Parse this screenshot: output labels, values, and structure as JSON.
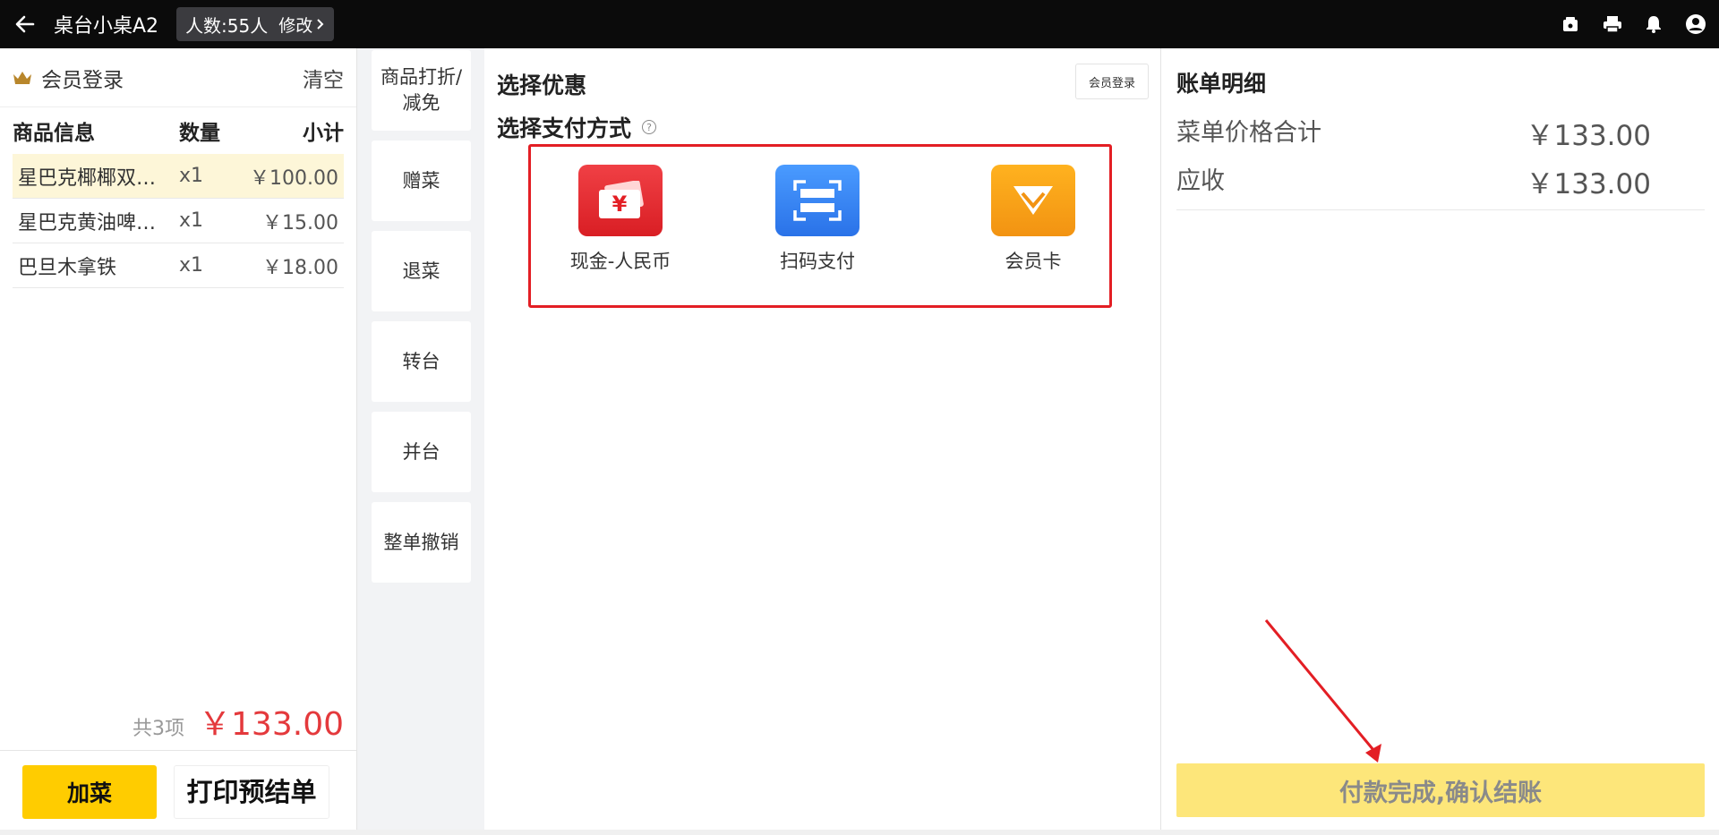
{
  "header": {
    "title": "桌台小桌A2",
    "people_label": "人数:55人",
    "edit_label": "修改",
    "icons": [
      "back-arrow-icon",
      "cash-drawer-icon",
      "printer-icon",
      "bell-icon",
      "user-avatar-icon"
    ]
  },
  "left": {
    "member_login": "会员登录",
    "clear": "清空",
    "columns": {
      "name": "商品信息",
      "qty": "数量",
      "subtotal": "小计"
    },
    "items": [
      {
        "name": "星巴克椰椰双…",
        "qty": "x1",
        "price": "￥100.00"
      },
      {
        "name": "星巴克黄油啤…",
        "qty": "x1",
        "price": "￥15.00"
      },
      {
        "name": "巴旦木拿铁",
        "qty": "x1",
        "price": "￥18.00"
      }
    ],
    "count": "共3项",
    "total": "￥133.00",
    "add_button": "加菜",
    "print_button": "打印预结单"
  },
  "actions": [
    {
      "label": "商品打折/减免"
    },
    {
      "label": "赠菜"
    },
    {
      "label": "退菜"
    },
    {
      "label": "转台"
    },
    {
      "label": "并台"
    },
    {
      "label": "整单撤销"
    }
  ],
  "middle": {
    "discount_title": "选择优惠",
    "payment_title": "选择支付方式",
    "member_login_small": "会员登录",
    "payments": [
      {
        "label": "现金-人民币",
        "icon": "cash-rmb-icon",
        "color": "#e8232a"
      },
      {
        "label": "扫码支付",
        "icon": "scan-pay-icon",
        "color": "#2f7ff0"
      },
      {
        "label": "会员卡",
        "icon": "member-card-icon",
        "color": "#f7a21a"
      }
    ]
  },
  "right": {
    "title": "账单明细",
    "menu_total_label": "菜单价格合计",
    "menu_total_value": "￥133.00",
    "receivable_label": "应收",
    "receivable_value": "￥133.00",
    "confirm_button": "付款完成,确认结账"
  },
  "colors": {
    "accent": "#ffcc00",
    "price_red": "#e4393c",
    "highlight_border": "#e31e24",
    "annotation_arrow": "#e31e24"
  }
}
